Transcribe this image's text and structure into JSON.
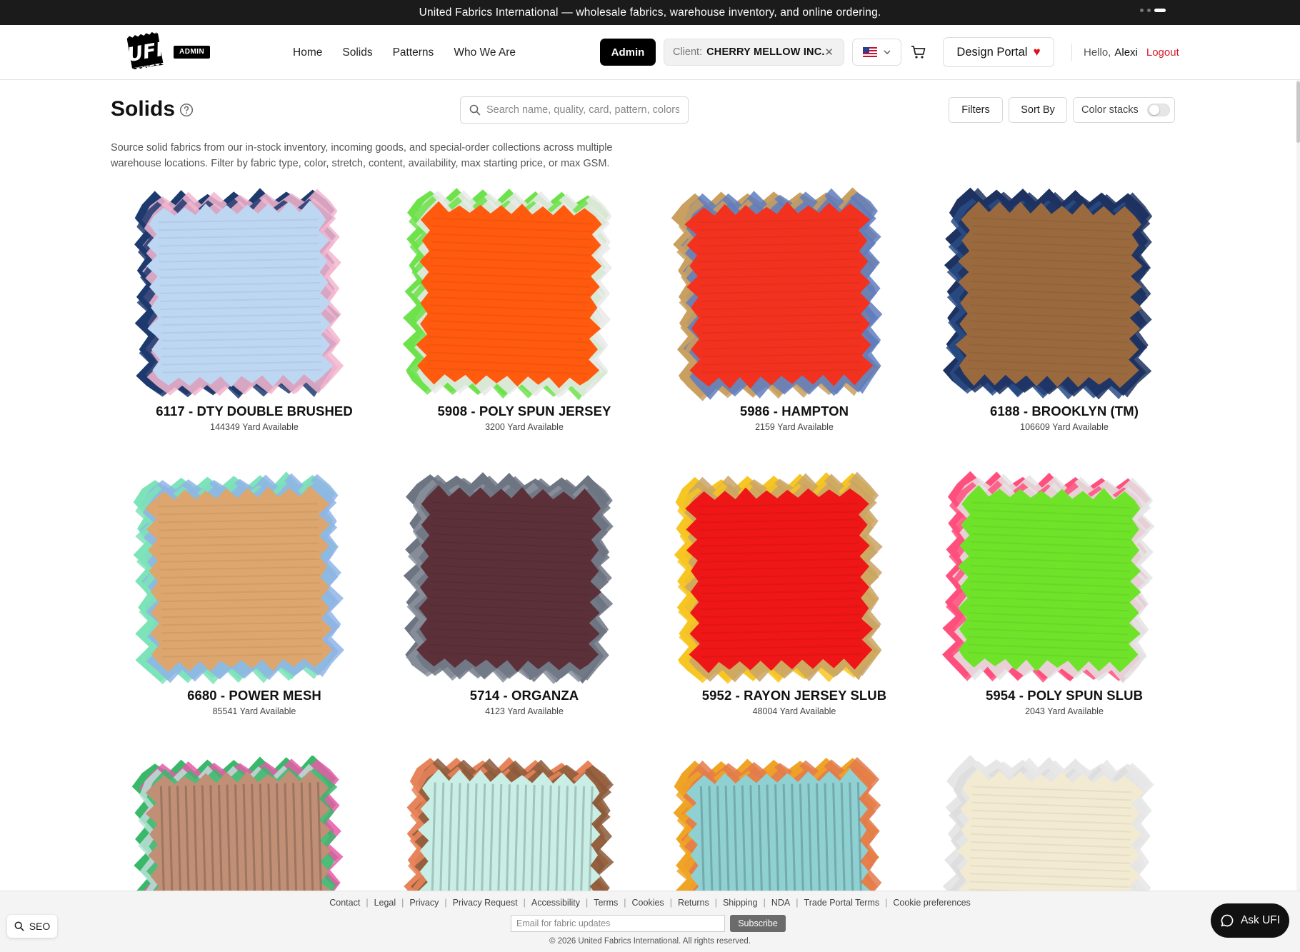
{
  "announcement": {
    "text": "United Fabrics International — wholesale fabrics, warehouse inventory, and online ordering."
  },
  "header": {
    "badge": "ADMIN",
    "nav": [
      "Home",
      "Solids",
      "Patterns",
      "Who We Are"
    ],
    "admin_button": "Admin",
    "client_label": "Client:",
    "client_value": "CHERRY MELLOW INC.",
    "design_portal": "Design Portal",
    "hello": "Hello,",
    "user_name": "Alexi",
    "logout": "Logout"
  },
  "page": {
    "title": "Solids",
    "search_placeholder": "Search name, quality, card, pattern, colors",
    "filters": "Filters",
    "sort_by": "Sort By",
    "color_stacks": "Color stacks",
    "description": "Source solid fabrics from our in-stock inventory, incoming goods, and special-order collections across multiple warehouse locations. Filter by fabric type, color, stretch, content, availability, max starting price, or max GSM."
  },
  "products": [
    {
      "title": "6117 - DTY DOUBLE BRUSHED",
      "availability": "144349 Yard Available",
      "color": "#bdd6f2",
      "edge": [
        "#1d3a6e",
        "#f3b6cf",
        "#1d3a6e",
        "#f3b6cf"
      ]
    },
    {
      "title": "5908 - POLY SPUN JERSEY",
      "availability": "3200 Yard Available",
      "color": "#ff5a0e",
      "edge": [
        "#6de24b",
        "#eaeaea",
        "#6de24b",
        "#eaeaea"
      ]
    },
    {
      "title": "5986 - HAMPTON",
      "availability": "2159 Yard Available",
      "color": "#f2321f",
      "edge": [
        "#c9a060",
        "#5f7dbf",
        "#c9a060",
        "#5f7dbf"
      ]
    },
    {
      "title": "6188 - BROOKLYN (TM)",
      "availability": "106609 Yard Available",
      "color": "#9a6a3e",
      "edge": [
        "#1d3260",
        "#1d3260",
        "#2a4c86",
        "#1d3260"
      ]
    },
    {
      "title": "6680 - POWER MESH",
      "availability": "85541 Yard Available",
      "color": "#dca66e",
      "edge": [
        "#7de3b9",
        "#8fb4e6",
        "#7de3b9",
        "#8fb4e6"
      ]
    },
    {
      "title": "5714 - ORGANZA",
      "availability": "4123 Yard Available",
      "color": "#5c3038",
      "edge": [
        "#6e7582",
        "#6e7582",
        "#8b929e",
        "#6e7582"
      ]
    },
    {
      "title": "5952 - RAYON JERSEY SLUB",
      "availability": "48004 Yard Available",
      "color": "#ee1616",
      "edge": [
        "#f7c623",
        "#c9a468",
        "#f7c623",
        "#c9a468"
      ]
    },
    {
      "title": "5954 - POLY SPUN SLUB",
      "availability": "2043 Yard Available",
      "color": "#6fe32a",
      "edge": [
        "#ff4f7d",
        "#e4e4e4",
        "#ff4f7d",
        "#e4e4e4"
      ]
    },
    {
      "title": "",
      "availability": "",
      "color": "#c08f76",
      "edge": [
        "#3ab86a",
        "#e85aa8",
        "#b7e2d6",
        "#3ab86a"
      ]
    },
    {
      "title": "",
      "availability": "",
      "color": "#c8eee5",
      "edge": [
        "#e8845b",
        "#8a5a3b",
        "#e8845b",
        "#8a5a3b"
      ]
    },
    {
      "title": "",
      "availability": "",
      "color": "#8fd0d2",
      "edge": [
        "#f0a424",
        "#e37a4d",
        "#f0a424",
        "#e37a4d"
      ]
    },
    {
      "title": "",
      "availability": "",
      "color": "#f3ead2",
      "edge": [
        "#e6e6e6",
        "#e6e6e6",
        "#dcdcdc",
        "#e6e6e6"
      ]
    }
  ],
  "footer": {
    "links": [
      "Contact",
      "Legal",
      "Privacy",
      "Privacy Request",
      "Accessibility",
      "Terms",
      "Cookies",
      "Returns",
      "Shipping",
      "NDA",
      "Trade Portal Terms",
      "Cookie preferences"
    ],
    "email_placeholder": "Email for fabric updates",
    "subscribe": "Subscribe",
    "copyright": "© 2026 United Fabrics International. All rights reserved."
  },
  "widgets": {
    "seo": "SEO",
    "ask": "Ask UFI"
  },
  "colors": {
    "brand_black": "#000000",
    "logout_red": "#d61a2b",
    "heart_red": "#e0121b"
  }
}
